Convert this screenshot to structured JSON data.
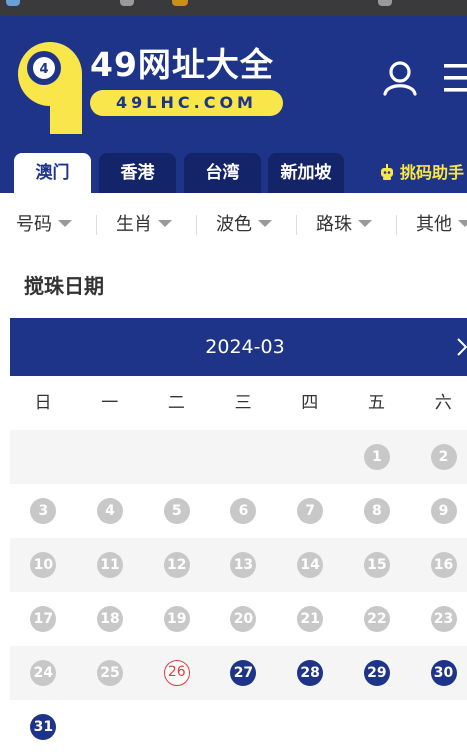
{
  "brand": {
    "ball_number": "4",
    "logo_digit": "9",
    "title": "49网址大全",
    "url": "49LHC.COM"
  },
  "header_icons": [
    "user-icon",
    "menu-icon"
  ],
  "tabs": [
    {
      "label": "澳门",
      "active": true
    },
    {
      "label": "香港",
      "active": false
    },
    {
      "label": "台湾",
      "active": false
    },
    {
      "label": "新加坡",
      "active": false
    }
  ],
  "helper": {
    "label": "挑码助手",
    "icon": "robot-icon"
  },
  "filters": [
    {
      "label": "号码"
    },
    {
      "label": "生肖"
    },
    {
      "label": "波色"
    },
    {
      "label": "路珠"
    },
    {
      "label": "其他"
    }
  ],
  "section_title": "搅珠日期",
  "calendar": {
    "month": "2024-03",
    "next_icon": "chevron-right-icon",
    "weekdays": [
      "日",
      "一",
      "二",
      "三",
      "四",
      "五",
      "六"
    ],
    "first_weekday": 5,
    "days_in_month": 31,
    "today": 26,
    "colors": {
      "past": "#c8c8c8",
      "today": "#e83b3b",
      "future": "#1e3489"
    }
  },
  "colors": {
    "brand_blue": "#1e3489",
    "tab_inactive": "#142468",
    "accent_yellow": "#f9e64a"
  }
}
